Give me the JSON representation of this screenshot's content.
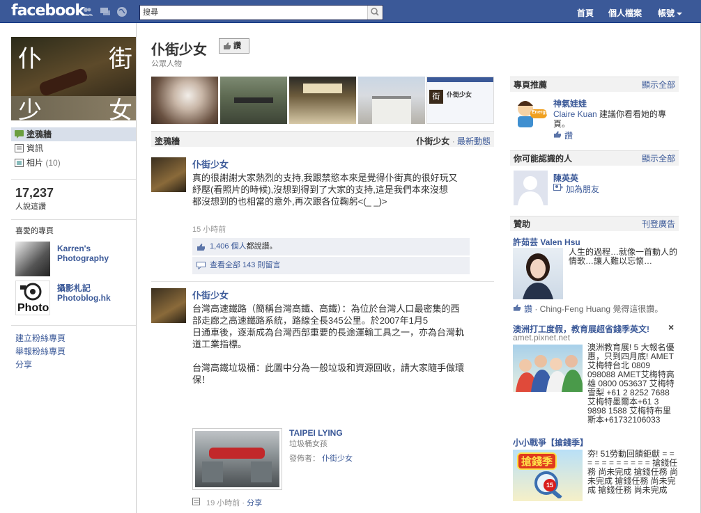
{
  "topbar": {
    "logo": "facebook",
    "search_placeholder": "搜尋",
    "nav": [
      "首頁",
      "個人檔案",
      "帳號"
    ]
  },
  "left": {
    "profile_chars": [
      "仆",
      "街",
      "少",
      "女"
    ],
    "nav": [
      {
        "label": "塗鴉牆",
        "icon": "wall-icon"
      },
      {
        "label": "資訊",
        "icon": "info-icon"
      },
      {
        "label": "相片",
        "count": "(10)",
        "icon": "photos-icon"
      }
    ],
    "likes_count": "17,237",
    "likes_label": "人說這讚",
    "favorites_title": "喜愛的專頁",
    "favorites": [
      {
        "name": "Karren's Photography"
      },
      {
        "name": "攝影札記 Photoblog.hk"
      }
    ],
    "photo_logo_text": "Photo",
    "links": [
      "建立粉絲專頁",
      "舉報粉絲專頁",
      "分享"
    ]
  },
  "page": {
    "title": "仆街少女",
    "like_button": "讚",
    "category": "公眾人物",
    "mini_page_name": "仆街少女",
    "mini_page_char": "街"
  },
  "wall": {
    "tab": "塗鴉牆",
    "filter_name": "仆街少女",
    "filter_sep": "·",
    "filter_link": "最新動態"
  },
  "stories": [
    {
      "actor": "仆街少女",
      "text": "真的很謝謝大家熱烈的支持,我跟禁慾本來是覺得仆街真的很好玩又\n紓壓(看照片的時候),沒想到得到了大家的支持,這是我們本來沒想\n都沒想到的也相當的意外,再次跟各位鞠躬<(_ _)>",
      "time": "15 小時前",
      "likes_link": "1,406 個人",
      "likes_suffix": "都說讚。",
      "comments": "查看全部 143 則留言"
    },
    {
      "actor": "仆街少女",
      "text": "台灣高速鐵路（簡稱台灣高鐵、高鐵）：為位於台灣人口最密集的西\n部走廊之高速鐵路系統，路線全長345公里。於2007年1月5\n日通車後，逐漸成為台灣西部重要的長途運輸工具之一，亦為台灣軌\n道工業指標。\n\n台灣高鐵垃圾桶：此圖中分為一般垃圾和資源回收，請大家隨手做環\n保！",
      "attachment_title": "TAIPEI LYING",
      "attachment_sub": "垃圾桶女孩",
      "attachment_by_label": "發佈者：",
      "attachment_by": "仆街少女",
      "time": "19 小時前",
      "share": "分享"
    }
  ],
  "right": {
    "suggest": {
      "title": "專頁推薦",
      "more": "顯示全部",
      "name": "神氣娃娃",
      "badge_text": "Energy",
      "recommender": "Claire Kuan",
      "text": " 建議你看看她的專頁。",
      "like": "讚"
    },
    "pymk": {
      "title": "你可能認識的人",
      "more": "顯示全部",
      "name": "陳英英",
      "add": "加為朋友"
    },
    "sponsored": {
      "title": "贊助",
      "more": "刊登廣告",
      "ads": [
        {
          "title": "許茹芸 Valen Hsu",
          "body": "人生的過程…就像一首動人的情歌…讓人難以忘懷…",
          "like": "讚",
          "social": " · Ching-Feng Huang 覺得這很讚。"
        },
        {
          "title": "澳洲打工度假，教育展超省錢季英文!",
          "url": "amet.pixnet.net",
          "close": "×",
          "body": "澳洲教育展! 5 大報名優惠，只到四月底! AMET艾梅特台北 0809 098088 AMET艾梅特高雄 0800 053637 艾梅特 雪梨 +61 2 8252 7688 艾梅特墨爾本+61 3 9898 1588 艾梅特布里斯本+61732106033"
        },
        {
          "title": "小小戰爭【搶錢季】",
          "img_text": "搶錢季",
          "badge": "15",
          "body": "夯! 51勞動回饋鉅獻 = = = = = = = = = = = 搶錢任務 尚未完成 搶錢任務 尚未完成 搶錢任務 尚未完成 搶錢任務 尚未完成"
        }
      ]
    }
  },
  "colors": {
    "brand": "#3b5998",
    "panel": "#f2f2f2",
    "ufi": "#edeff4"
  }
}
